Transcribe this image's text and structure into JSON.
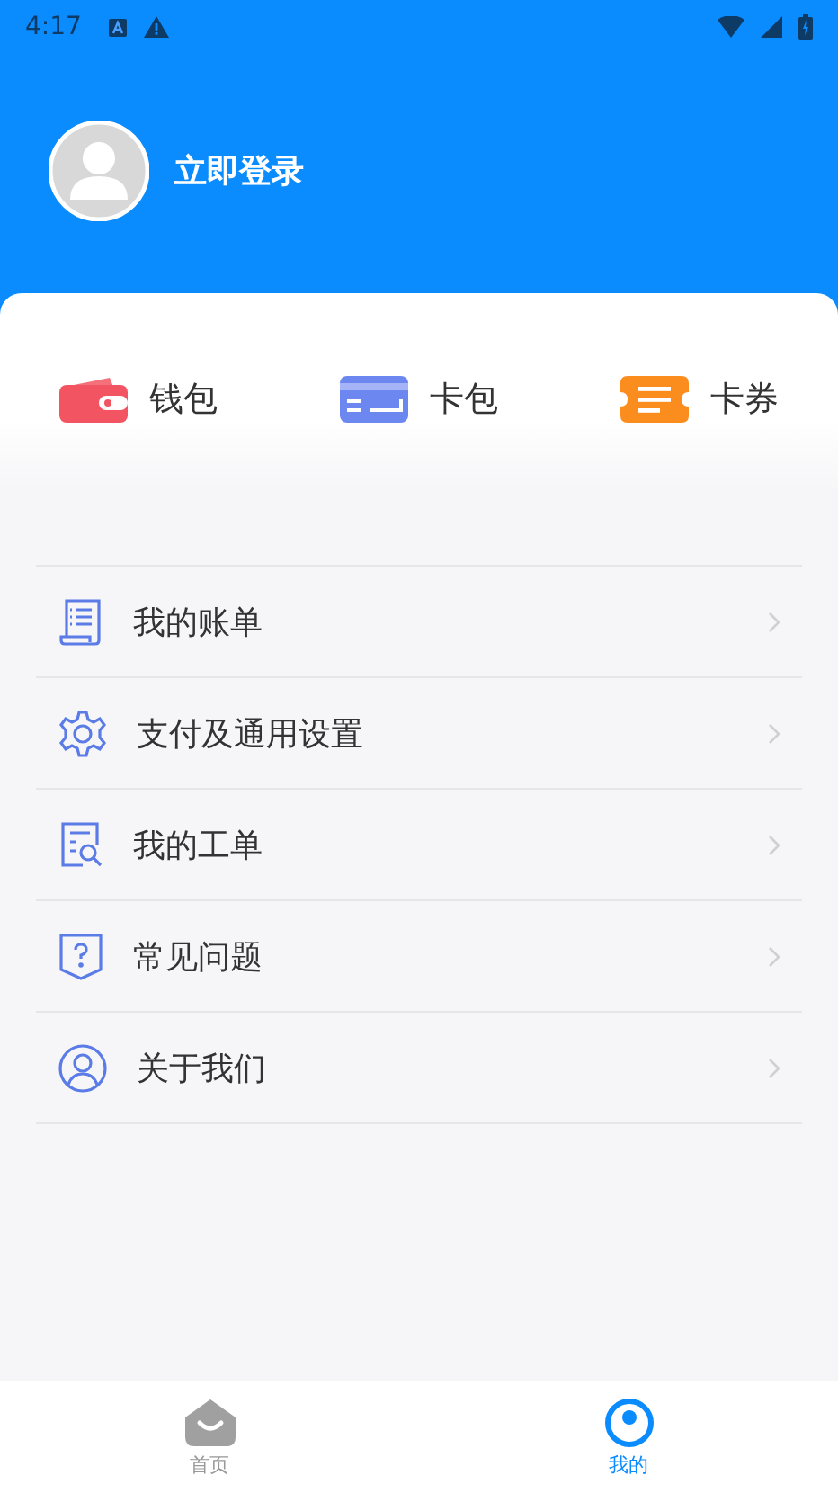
{
  "status_bar": {
    "time": "4:17"
  },
  "profile": {
    "login_label": "立即登录"
  },
  "quick_actions": [
    {
      "kind": "wallet",
      "label": "钱包"
    },
    {
      "kind": "card",
      "label": "卡包"
    },
    {
      "kind": "coupon",
      "label": "卡券"
    }
  ],
  "menu": [
    {
      "kind": "bill",
      "label": "我的账单"
    },
    {
      "kind": "settings",
      "label": "支付及通用设置"
    },
    {
      "kind": "ticket",
      "label": "我的工单"
    },
    {
      "kind": "faq",
      "label": "常见问题"
    },
    {
      "kind": "about",
      "label": "关于我们"
    }
  ],
  "bottom_nav": [
    {
      "kind": "home",
      "label": "首页",
      "selected": false
    },
    {
      "kind": "me",
      "label": "我的",
      "selected": true
    }
  ]
}
